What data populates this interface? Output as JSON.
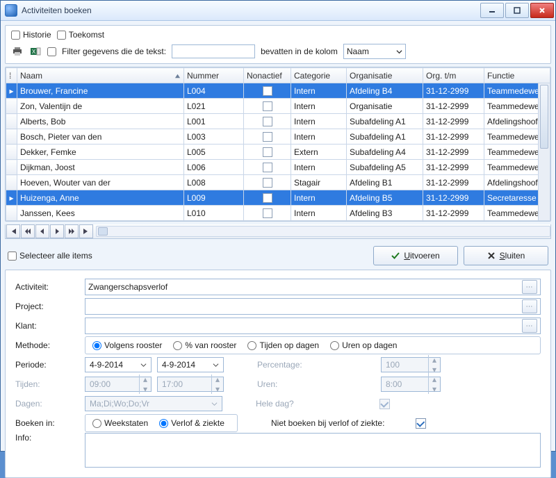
{
  "window": {
    "title": "Activiteiten boeken"
  },
  "topbox": {
    "historie": "Historie",
    "toekomst": "Toekomst",
    "filter_pre": "Filter gegevens die de tekst:",
    "filter_mid": "bevatten in de kolom",
    "filter_value": "",
    "column_select": "Naam"
  },
  "columns": {
    "naam": "Naam",
    "nummer": "Nummer",
    "nonactief": "Nonactief",
    "categorie": "Categorie",
    "organisatie": "Organisatie",
    "org_tm": "Org. t/m",
    "functie": "Functie"
  },
  "rows": [
    {
      "sel": true,
      "marker": "▸",
      "naam": "Brouwer, Francine",
      "nummer": "L004",
      "categorie": "Intern",
      "organisatie": "Afdeling B4",
      "org_tm": "31-12-2999",
      "functie": "Teammedewer"
    },
    {
      "sel": false,
      "marker": "",
      "naam": "Zon, Valentijn de",
      "nummer": "L021",
      "categorie": "Intern",
      "organisatie": "Organisatie",
      "org_tm": "31-12-2999",
      "functie": "Teammedewer"
    },
    {
      "sel": false,
      "marker": "",
      "naam": "Alberts, Bob",
      "nummer": "L001",
      "categorie": "Intern",
      "organisatie": "Subafdeling A1",
      "org_tm": "31-12-2999",
      "functie": "Afdelingshoofd"
    },
    {
      "sel": false,
      "marker": "",
      "naam": "Bosch, Pieter van den",
      "nummer": "L003",
      "categorie": "Intern",
      "organisatie": "Subafdeling A1",
      "org_tm": "31-12-2999",
      "functie": "Teammedewer"
    },
    {
      "sel": false,
      "marker": "",
      "naam": "Dekker, Femke",
      "nummer": "L005",
      "categorie": "Extern",
      "organisatie": "Subafdeling A4",
      "org_tm": "31-12-2999",
      "functie": "Teammedewer"
    },
    {
      "sel": false,
      "marker": "",
      "naam": "Dijkman, Joost",
      "nummer": "L006",
      "categorie": "Intern",
      "organisatie": "Subafdeling A5",
      "org_tm": "31-12-2999",
      "functie": "Teammedewer"
    },
    {
      "sel": false,
      "marker": "",
      "naam": "Hoeven, Wouter van der",
      "nummer": "L008",
      "categorie": "Stagair",
      "organisatie": "Afdeling B1",
      "org_tm": "31-12-2999",
      "functie": "Afdelingshoofd"
    },
    {
      "sel": true,
      "marker": "▸",
      "naam": "Huizenga, Anne",
      "nummer": "L009",
      "categorie": "Intern",
      "organisatie": "Afdeling B5",
      "org_tm": "31-12-2999",
      "functie": "Secretaresse"
    },
    {
      "sel": false,
      "marker": "",
      "naam": "Janssen, Kees",
      "nummer": "L010",
      "categorie": "Intern",
      "organisatie": "Afdeling B3",
      "org_tm": "31-12-2999",
      "functie": "Teammedewer"
    }
  ],
  "actions": {
    "select_all": "Selecteer alle items",
    "uitvoeren": "itvoeren",
    "uitvoeren_key": "U",
    "sluiten": "luiten",
    "sluiten_key": "S"
  },
  "form": {
    "labels": {
      "activiteit": "Activiteit:",
      "project": "Project:",
      "klant": "Klant:",
      "methode": "Methode:",
      "periode": "Periode:",
      "tijden": "Tijden:",
      "dagen": "Dagen:",
      "boeken_in": "Boeken in:",
      "info": "Info:"
    },
    "activiteit": "Zwangerschapsverlof",
    "project": "",
    "klant": "",
    "methode": {
      "opt1": "Volgens rooster",
      "opt2": "% van rooster",
      "opt3": "Tijden op dagen",
      "opt4": "Uren op dagen"
    },
    "periode_from": "4-9-2014",
    "periode_to": "4-9-2014",
    "tijden_from": "09:00",
    "tijden_to": "17:00",
    "dagen": "Ma;Di;Wo;Do;Vr",
    "boeken_in": {
      "opt1": "Weekstaten",
      "opt2": "Verlof & ziekte"
    },
    "side": {
      "percentage_label": "Percentage:",
      "percentage_value": "100",
      "uren_label": "Uren:",
      "uren_value": "8:00",
      "hele_dag_label": "Hele dag?",
      "niet_boeken_label": "Niet boeken bij verlof of ziekte:"
    },
    "info": ""
  }
}
